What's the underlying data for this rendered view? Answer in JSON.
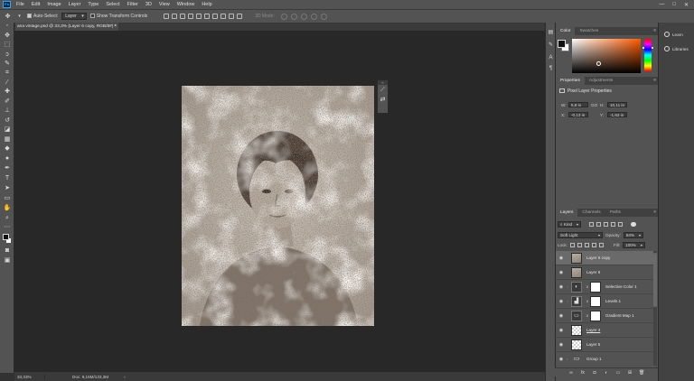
{
  "menubar": {
    "logo": "Ps",
    "items": [
      "File",
      "Edit",
      "Image",
      "Layer",
      "Type",
      "Select",
      "Filter",
      "3D",
      "View",
      "Window",
      "Help"
    ],
    "window_controls": [
      "—",
      "□",
      "✕"
    ]
  },
  "options": {
    "auto_select_label": "Auto-Select:",
    "auto_select_value": "Layer",
    "transform_label": "Show Transform Controls",
    "mode_3d_label": "3D Mode:"
  },
  "document": {
    "tab_title": "ana vintage.psd @ 33,3% (Layer 6 copy, RGB/8#) *",
    "tab_close": "×"
  },
  "status": {
    "zoom": "33,33%",
    "doc_size": "Doc: 9,16M/133,3M",
    "arrow": "›"
  },
  "color_panel": {
    "tabs": [
      "Color",
      "Swatches"
    ],
    "fg_color": "#111111",
    "bg_color": "#ffffff"
  },
  "properties_panel": {
    "tabs": [
      "Properties",
      "Adjustments"
    ],
    "title": "Pixel Layer Properties",
    "w_label": "W:",
    "w_value": "5,8 in",
    "h_label": "H:",
    "h_value": "10,11 in",
    "x_label": "X:",
    "x_value": "-0,13 in",
    "y_label": "Y:",
    "y_value": "-1,63 in",
    "link_glyph": "GO"
  },
  "layers_panel": {
    "tabs": [
      "Layers",
      "Channels",
      "Paths"
    ],
    "kind_value": "Kind",
    "blend_mode": "Soft Light",
    "opacity_label": "Opacity:",
    "opacity_value": "84%",
    "lock_label": "Lock:",
    "fill_label": "Fill:",
    "fill_value": "100%",
    "layers": [
      {
        "name": "Layer 6 copy",
        "thumb": "photo",
        "selected": true
      },
      {
        "name": "Layer 6",
        "thumb": "photo",
        "selected": false
      },
      {
        "name": "Selective Color 1",
        "thumb": "adj",
        "selected": false
      },
      {
        "name": "Levels 1",
        "thumb": "adj",
        "selected": false
      },
      {
        "name": "Gradient Map 1",
        "thumb": "adj",
        "selected": false
      },
      {
        "name": "Layer 4",
        "thumb": "checker",
        "selected": false
      },
      {
        "name": "Layer 5",
        "thumb": "checker",
        "selected": false
      },
      {
        "name": "Group 1",
        "thumb": "folder",
        "selected": false
      }
    ]
  },
  "right_panel": {
    "items": [
      "Learn",
      "Libraries"
    ]
  },
  "colors": {
    "accent": "#31a8ff",
    "chrome": "#535353",
    "canvas": "#282828"
  }
}
